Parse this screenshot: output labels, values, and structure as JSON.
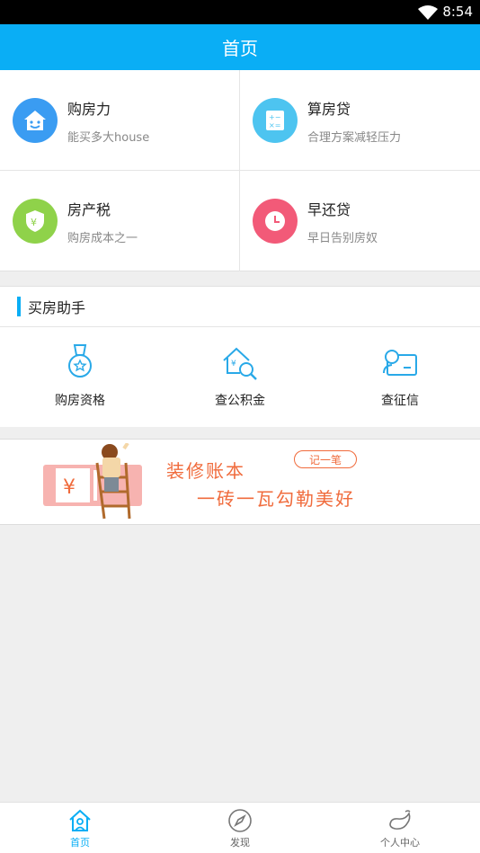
{
  "status_bar": {
    "time": "8:54"
  },
  "header": {
    "title": "首页"
  },
  "tools": [
    {
      "title": "购房力",
      "subtitle": "能买多大house",
      "color": "#3a9cf2",
      "icon": "smiling-house-icon"
    },
    {
      "title": "算房贷",
      "subtitle": "合理方案减轻压力",
      "color": "#4dc4f0",
      "icon": "calculator-icon"
    },
    {
      "title": "房产税",
      "subtitle": "购房成本之一",
      "color": "#8fd24a",
      "icon": "yuan-shield-icon"
    },
    {
      "title": "早还贷",
      "subtitle": "早日告别房奴",
      "color": "#f25a78",
      "icon": "clock-icon"
    }
  ],
  "assistant": {
    "title": "买房助手",
    "items": [
      {
        "label": "购房资格",
        "icon": "medal-icon"
      },
      {
        "label": "查公积金",
        "icon": "house-search-icon"
      },
      {
        "label": "查征信",
        "icon": "credit-card-user-icon"
      }
    ]
  },
  "banner": {
    "line1": "装修账本",
    "line2": "一砖一瓦勾勒美好",
    "pill": "记一笔"
  },
  "bottom_nav": [
    {
      "label": "首页",
      "icon": "home-icon",
      "active": true
    },
    {
      "label": "发现",
      "icon": "compass-icon",
      "active": false
    },
    {
      "label": "个人中心",
      "icon": "whale-icon",
      "active": false
    }
  ],
  "colors": {
    "accent": "#0aaef5",
    "banner_text": "#f06b3c"
  }
}
